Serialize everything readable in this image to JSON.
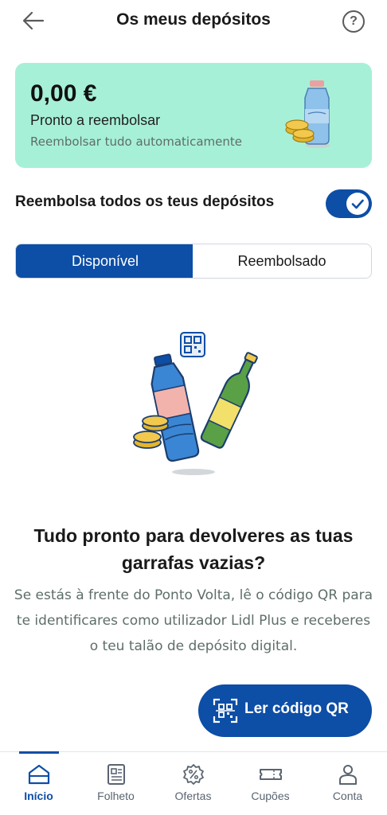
{
  "header": {
    "title": "Os meus depósitos",
    "help": "?"
  },
  "card": {
    "amount": "0,00 €",
    "status": "Pronto a reembolsar",
    "auto_link": "Reembolsar tudo automaticamente"
  },
  "toggle": {
    "label": "Reembolsa todos os teus depósitos",
    "on": true
  },
  "segment": {
    "tabs": [
      {
        "label": "Disponível",
        "active": true
      },
      {
        "label": "Reembolsado",
        "active": false
      }
    ]
  },
  "empty_state": {
    "headline": "Tudo pronto para devolveres as tuas garrafas vazias?",
    "description": "Se estás à frente do Ponto Volta, lê o código QR para te identificares como utilizador Lidl Plus e receberes o teu talão de depósito digital."
  },
  "qr_button": {
    "label": "Ler código QR"
  },
  "tabbar": {
    "items": [
      {
        "label": "Início",
        "icon": "home-icon",
        "active": true
      },
      {
        "label": "Folheto",
        "icon": "leaflet-icon",
        "active": false
      },
      {
        "label": "Ofertas",
        "icon": "offers-icon",
        "active": false
      },
      {
        "label": "Cupões",
        "icon": "coupons-icon",
        "active": false
      },
      {
        "label": "Conta",
        "icon": "account-icon",
        "active": false
      }
    ]
  },
  "colors": {
    "primary": "#0d4ea6",
    "card_bg": "#a7f0d8",
    "muted_text": "#5e6e68"
  }
}
